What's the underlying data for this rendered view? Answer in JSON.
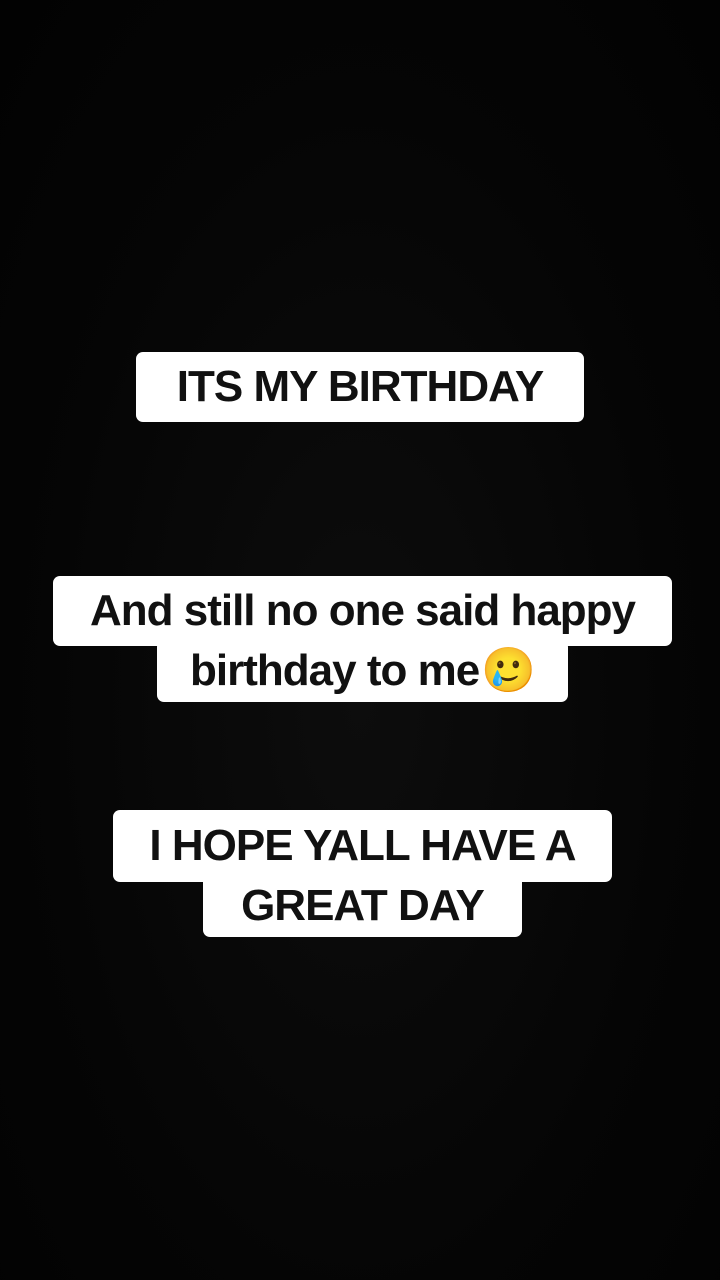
{
  "story": {
    "captions": [
      {
        "lines": [
          "ITS MY BIRTHDAY"
        ]
      },
      {
        "lines": [
          "And still no one said happy",
          "birthday to me"
        ],
        "trailing_emoji": "🥲"
      },
      {
        "lines": [
          "I HOPE YALL HAVE A",
          "GREAT DAY"
        ]
      }
    ]
  },
  "colors": {
    "background": "#050505",
    "caption_background": "#ffffff",
    "caption_text": "#111111"
  }
}
